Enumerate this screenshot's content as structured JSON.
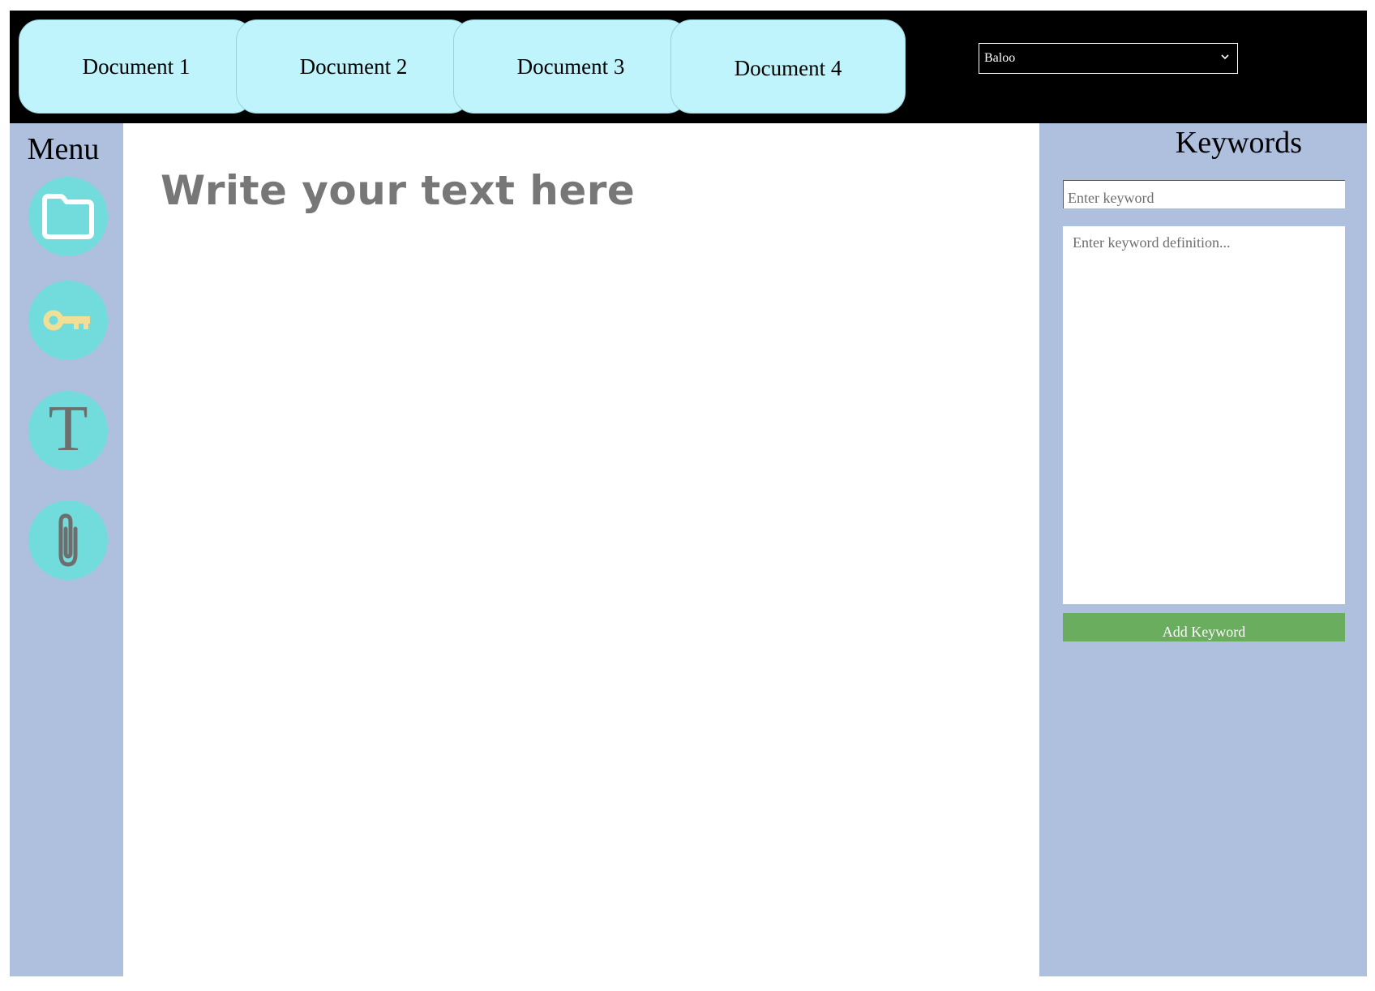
{
  "tabs": [
    {
      "label": "Document 1"
    },
    {
      "label": "Document 2"
    },
    {
      "label": "Document 3"
    },
    {
      "label": "Document 4"
    }
  ],
  "font_select": {
    "selected": "Baloo"
  },
  "menu": {
    "title": "Menu",
    "items": [
      {
        "icon": "folder-icon",
        "color": "#ffffff"
      },
      {
        "icon": "key-icon",
        "color": "#f0df96"
      },
      {
        "icon": "text-icon",
        "glyph": "T",
        "color": "#6e6e6e"
      },
      {
        "icon": "paperclip-icon",
        "color": "#6e6e6e"
      }
    ]
  },
  "editor": {
    "placeholder": "Write your text here"
  },
  "keywords": {
    "title": "Keywords",
    "keyword_placeholder": "Enter keyword",
    "definition_placeholder": "Enter keyword definition...",
    "add_button": "Add Keyword"
  },
  "colors": {
    "topbar": "#000000",
    "tab": "#bff4fc",
    "sidebar": "#aec0de",
    "menu_button": "#72dcdc",
    "add_button": "#6aad5e"
  }
}
